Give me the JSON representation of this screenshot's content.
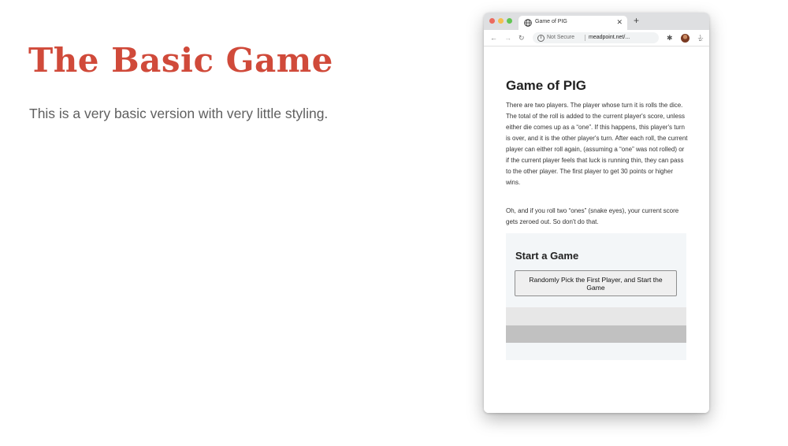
{
  "slide": {
    "title": "The Basic Game",
    "subtitle": "This is a very basic version with very little styling.",
    "title_color": "#d04a3a"
  },
  "browser": {
    "tab": {
      "title": "Game of PIG",
      "favicon": "globe-icon"
    },
    "address": {
      "security_label": "Not Secure",
      "url": "meadpoint.net/..."
    },
    "icons": [
      "back-arrow-icon",
      "forward-arrow-icon",
      "reload-icon",
      "info-icon",
      "star-icon",
      "extensions-puzzle-icon",
      "profile-avatar",
      "kebab-menu-icon"
    ]
  },
  "page": {
    "heading": "Game of PIG",
    "paragraphs": [
      "There are two players. The player whose turn it is rolls the dice. The total of the roll is added to the current player's score, unless either die comes up as a “one”. If this happens, this player's turn is over, and it is the other player's turn. After each roll, the current player can either roll again, (assuming a “one” was not rolled) or if the current player feels that luck is running thin, they can pass to the other player. The first player to get 30 points or higher wins.",
      "Oh, and if you roll two “ones” (snake eyes), your current score gets zeroed out. So don't do that."
    ],
    "start_game": {
      "heading": "Start a Game",
      "button_label": "Randomly Pick the First Player, and Start the Game"
    }
  }
}
